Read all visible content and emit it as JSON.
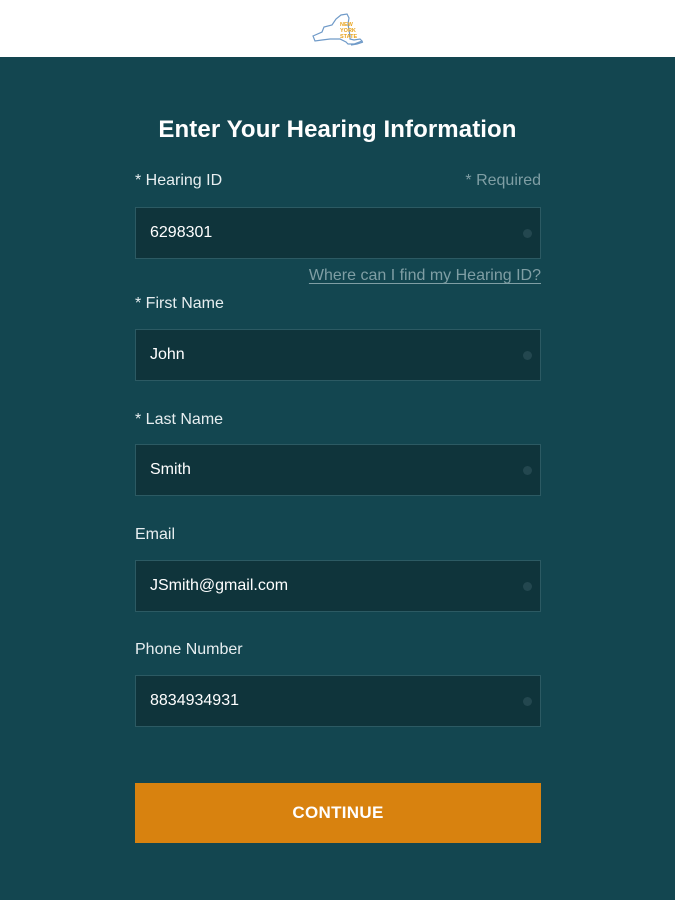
{
  "header": {
    "logo_text": "NEW YORK STATE"
  },
  "form": {
    "title": "Enter Your Hearing Information",
    "required_note": "* Required",
    "hearing_id": {
      "label": "* Hearing ID",
      "value": "6298301"
    },
    "help_link": "Where can I find my Hearing ID?",
    "first_name": {
      "label": "* First Name",
      "value": "John"
    },
    "last_name": {
      "label": "* Last Name",
      "value": "Smith"
    },
    "email": {
      "label": "Email",
      "value": "JSmith@gmail.com"
    },
    "phone": {
      "label": "Phone Number",
      "value": "8834934931"
    },
    "continue_label": "CONTINUE"
  },
  "colors": {
    "background": "#134650",
    "field_background": "#0f343b",
    "accent": "#d8820f"
  }
}
